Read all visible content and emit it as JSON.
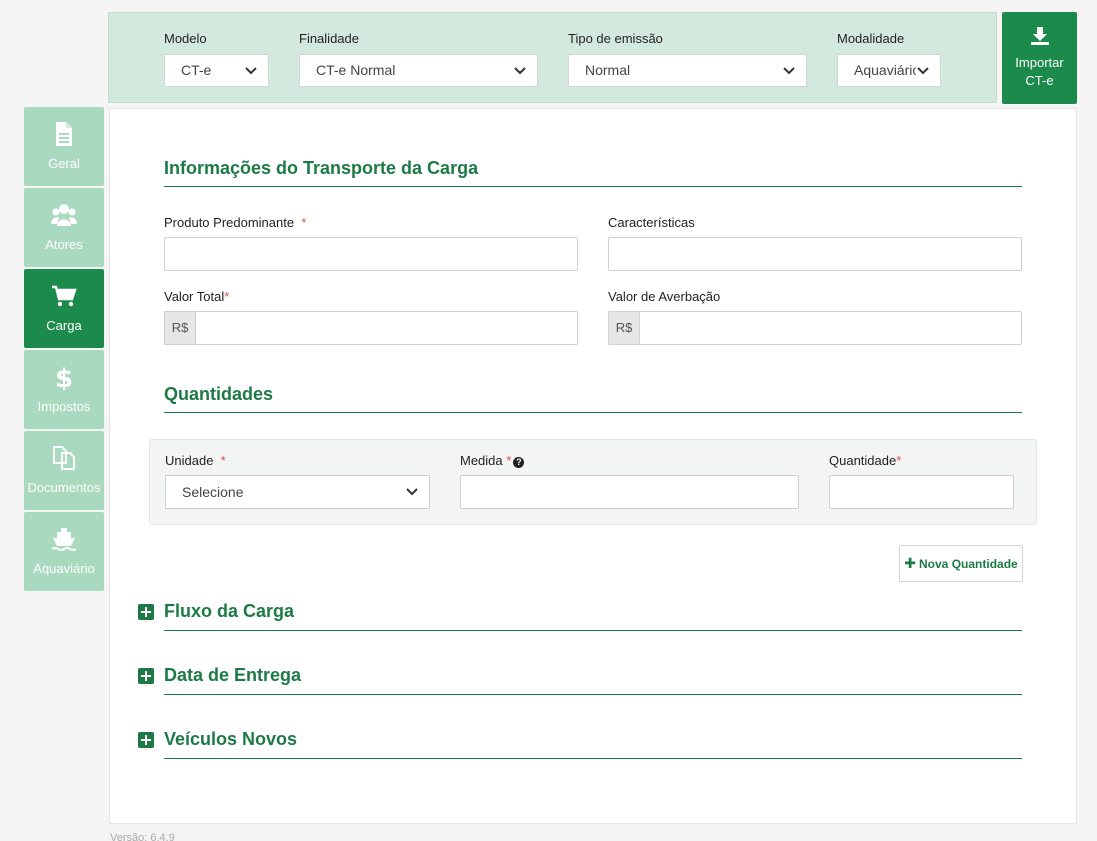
{
  "header": {
    "modelo": {
      "label": "Modelo",
      "value": "CT-e"
    },
    "finalidade": {
      "label": "Finalidade",
      "value": "CT-e Normal"
    },
    "tipo_emissao": {
      "label": "Tipo de emissão",
      "value": "Normal"
    },
    "modalidade": {
      "label": "Modalidade",
      "value": "Aquaviário"
    },
    "import_button": {
      "line1": "Importar",
      "line2": "CT-e",
      "icon": "download-icon"
    }
  },
  "sidebar": {
    "items": [
      {
        "label": "Geral",
        "icon": "document-icon",
        "active": false
      },
      {
        "label": "Atores",
        "icon": "users-icon",
        "active": false
      },
      {
        "label": "Carga",
        "icon": "cart-icon",
        "active": true
      },
      {
        "label": "Impostos",
        "icon": "dollar-icon",
        "active": false
      },
      {
        "label": "Documentos",
        "icon": "copy-icon",
        "active": false
      },
      {
        "label": "Aquaviário",
        "icon": "ship-icon",
        "active": false
      }
    ]
  },
  "transporte": {
    "title": "Informações do Transporte da Carga",
    "produto_label": "Produto Predominante",
    "caracteristicas_label": "Características",
    "valor_total_label": "Valor Total",
    "valor_averbacao_label": "Valor de Averbação",
    "currency": "R$",
    "required_mark": "*"
  },
  "quantidades": {
    "title": "Quantidades",
    "unidade_label": "Unidade",
    "unidade_value": "Selecione",
    "medida_label": "Medida",
    "quantidade_label": "Quantidade",
    "help_glyph": "?",
    "nova_button": "Nova Quantidade",
    "plus_glyph": "✚"
  },
  "sections": {
    "fluxo": "Fluxo da Carga",
    "data_entrega": "Data de Entrega",
    "veiculos": "Veículos Novos"
  },
  "footer": {
    "version": "Versão: 6.4.9"
  },
  "colors": {
    "primary": "#1b8a4b",
    "light": "#a9d9be",
    "header_bg": "#d4e9dd"
  }
}
